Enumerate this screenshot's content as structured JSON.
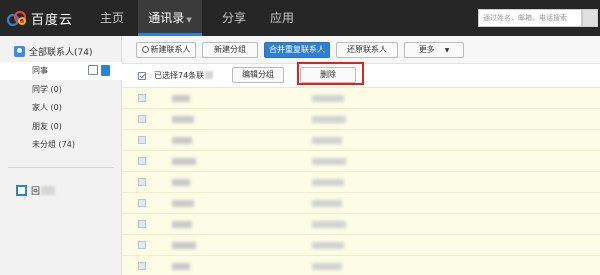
{
  "brand": {
    "name": "百度云"
  },
  "nav": [
    {
      "label": "主页",
      "active": false
    },
    {
      "label": "通讯录",
      "active": true
    },
    {
      "label": "分享",
      "active": false
    },
    {
      "label": "应用",
      "active": false
    }
  ],
  "search": {
    "placeholder": "通过姓名、邮箱、电话搜索"
  },
  "sidebar": {
    "header": "全部联系人(74)",
    "groups": [
      {
        "label": "同事"
      },
      {
        "label": "同学 (0)"
      },
      {
        "label": "家人 (0)"
      },
      {
        "label": "朋友 (0)"
      },
      {
        "label": "未分组 (74)"
      }
    ],
    "recycle_label": "回"
  },
  "toolbar": {
    "new_contact": "新建联系人",
    "new_group": "新建分组",
    "merge": "合并重复联系人",
    "restore": "还原联系人",
    "more": "更多"
  },
  "selection": {
    "text": "已选择74条联",
    "edit_group": "编辑分组",
    "delete": "删除"
  },
  "colors": {
    "accent": "#2f80d4",
    "highlight": "#e2231a",
    "list_bg": "#fdfde6",
    "topbar": "#262626"
  }
}
